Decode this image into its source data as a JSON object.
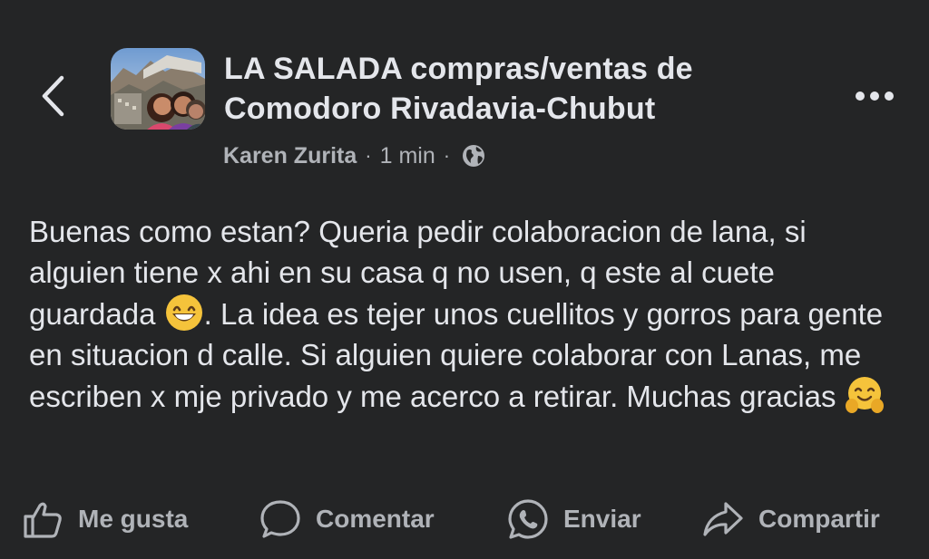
{
  "post": {
    "group_name": "LA SALADA compras/ventas de Comodoro Rivadavia-Chubut",
    "author": "Karen Zurita",
    "time": "1 min",
    "separator": "·",
    "text_part1": "Buenas como estan? Queria pedir colaboracion de lana, si alguien tiene x ahi en su casa q no usen, q este al cuete guardada ",
    "text_part2": ". La idea es tejer unos cuellitos y gorros para gente en situacion d calle. Si alguien quiere colaborar con Lanas, me escriben x mje privado y me acerco a retirar. Muchas gracias ",
    "emoji_1": "grinning-face-emoji",
    "emoji_2": "hugging-face-emoji"
  },
  "actions": {
    "like": "Me gusta",
    "comment": "Comentar",
    "send": "Enviar",
    "share": "Compartir"
  },
  "icons": {
    "back": "chevron-left-icon",
    "more": "more-horizontal-icon",
    "privacy": "globe-icon",
    "like": "thumbs-up-icon",
    "comment": "comment-bubble-icon",
    "send": "whatsapp-icon",
    "share": "share-arrow-icon"
  },
  "colors": {
    "background": "#242526",
    "primary_text": "#e4e6eb",
    "secondary_text": "#b0b3b8"
  }
}
